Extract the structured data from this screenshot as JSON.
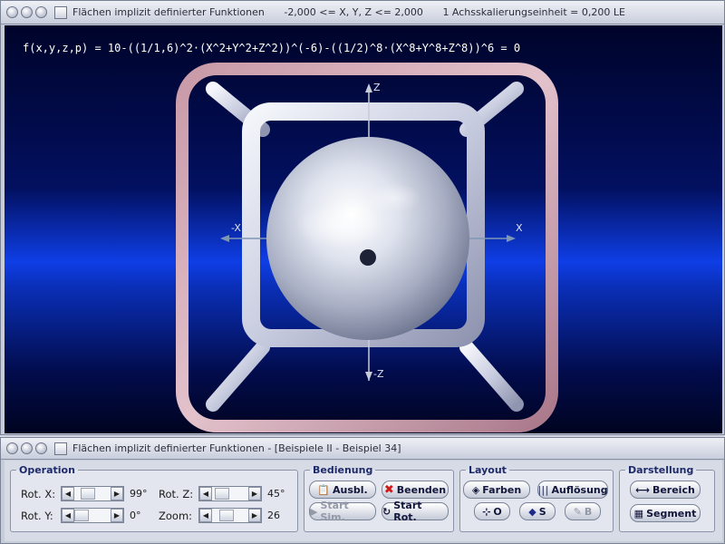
{
  "top_window": {
    "title_parts": [
      "Flächen implizit definierter Funktionen",
      "-2,000 <= X, Y, Z <= 2,000",
      "1 Achsskalierungseinheit = 0,200 LE"
    ],
    "formula": "f(x,y,z,p) = 10-((1/1,6)^2·(X^2+Y^2+Z^2))^(-6)-((1/2)^8·(X^8+Y^8+Z^8))^6 = 0",
    "axes": {
      "z_pos": "Z",
      "z_neg": "-Z",
      "x_pos": "X",
      "x_neg": "-X"
    }
  },
  "bottom_window": {
    "title": "Flächen implizit definierter Funktionen - [Beispiele II - Beispiel 34]",
    "operation": {
      "legend": "Operation",
      "rot_x": {
        "label": "Rot. X:",
        "value": "99°",
        "fraction": 0.28
      },
      "rot_y": {
        "label": "Rot. Y:",
        "value": "0°",
        "fraction": 0.0
      },
      "rot_z": {
        "label": "Rot. Z:",
        "value": "45°",
        "fraction": 0.12
      },
      "zoom": {
        "label": "Zoom:",
        "value": "26",
        "fraction": 0.35
      }
    },
    "bedienung": {
      "legend": "Bedienung",
      "ausbl": "Ausbl.",
      "beenden": "Beenden",
      "start_sim": "Start Sim.",
      "start_rot": "Start Rot."
    },
    "layout": {
      "legend": "Layout",
      "farben": "Farben",
      "aufloesung": "Auflösung",
      "o_btn": "O",
      "s_btn": "S",
      "b_btn": "B"
    },
    "darstellung": {
      "legend": "Darstellung",
      "bereich": "Bereich",
      "segment": "Segment"
    }
  }
}
